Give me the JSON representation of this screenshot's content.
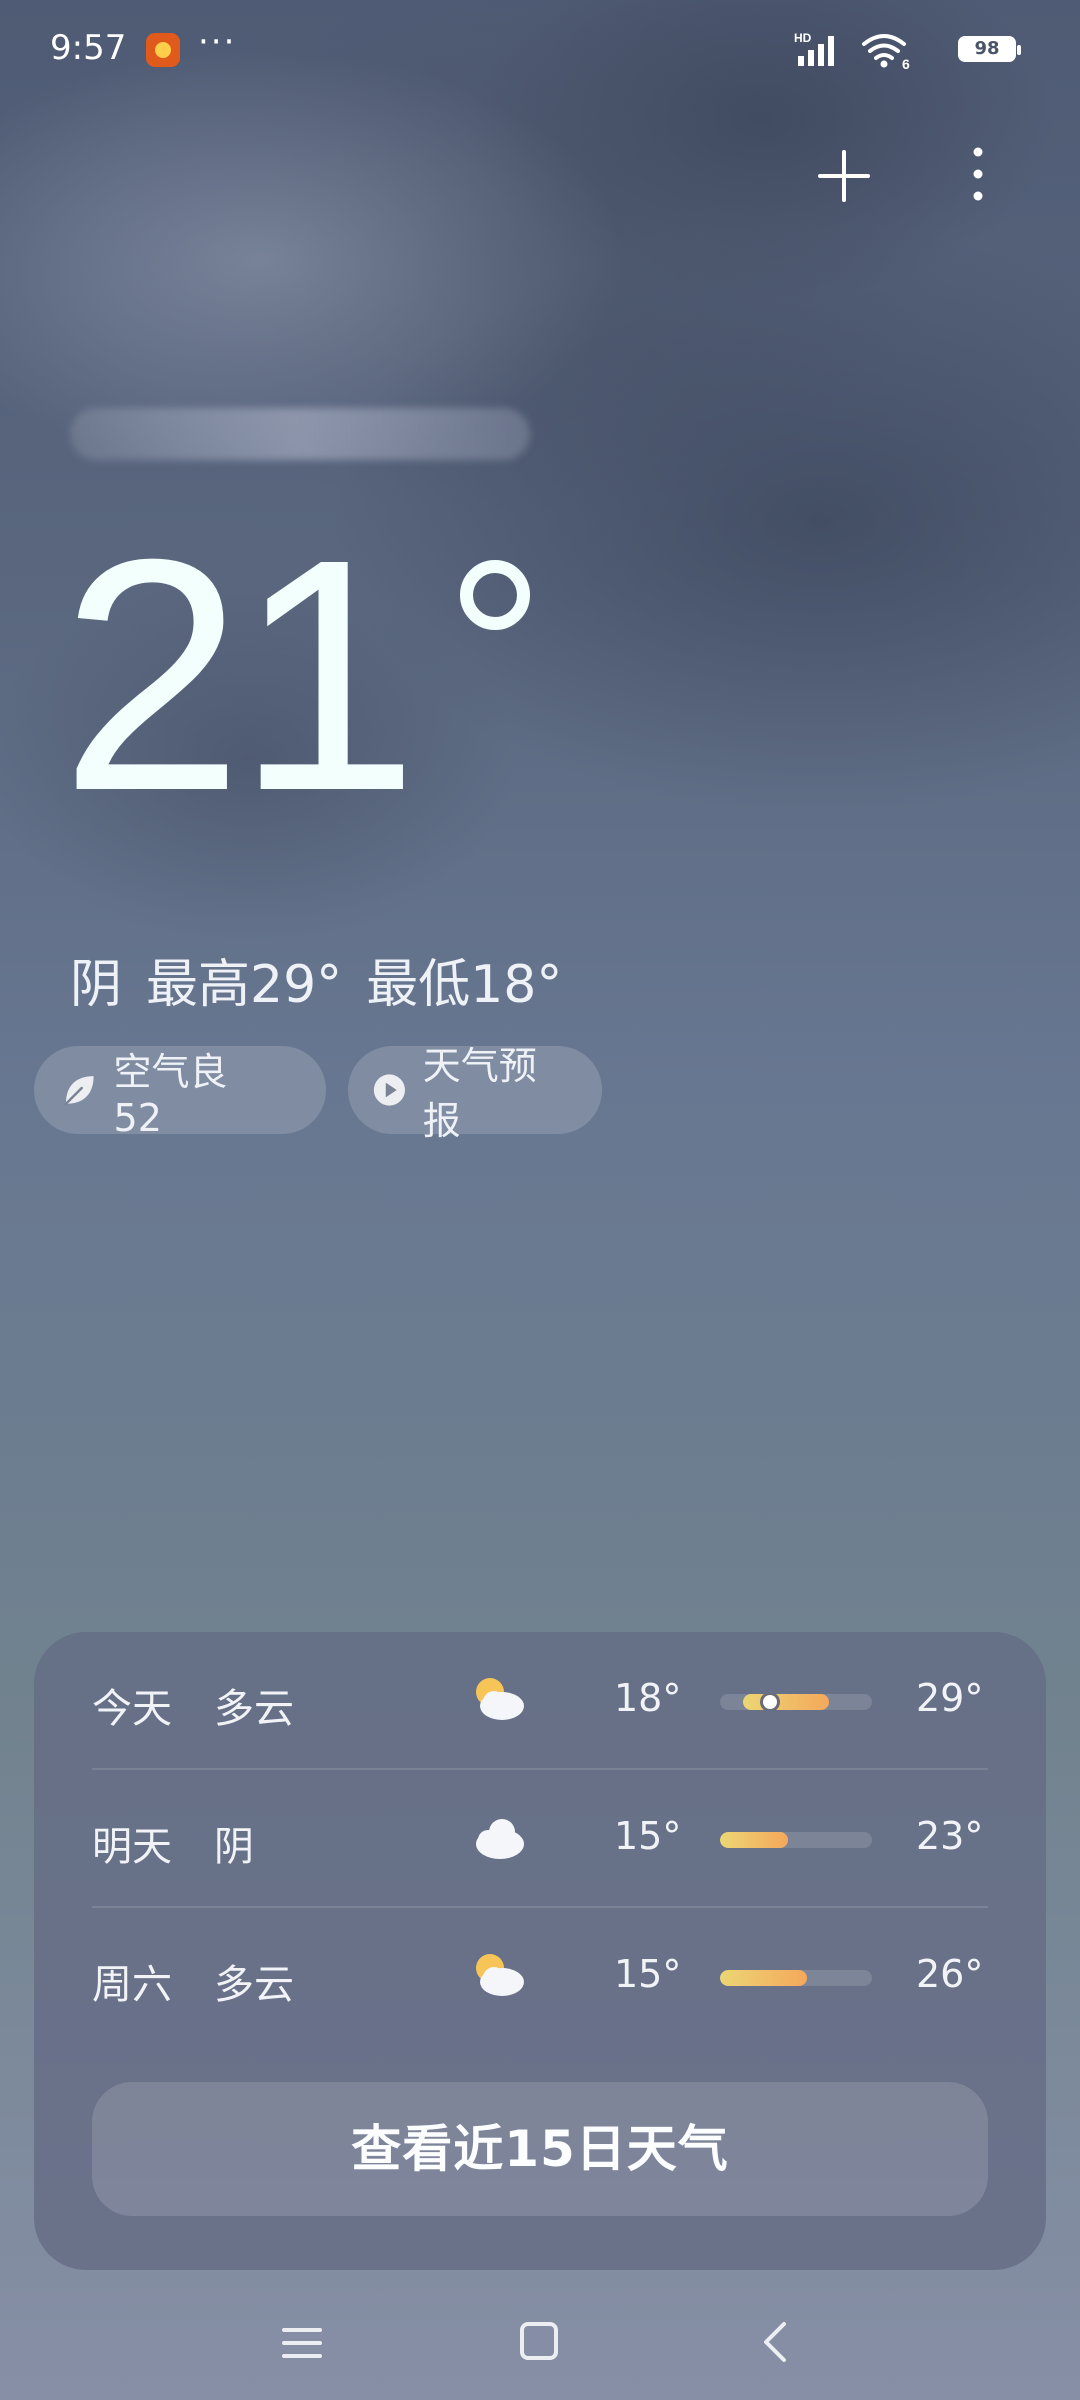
{
  "status_bar": {
    "time": "9:57",
    "overflow": "···",
    "network_tag": "HD",
    "wifi_tag": "6",
    "battery": "98"
  },
  "header": {
    "add_city_icon": "plus-icon",
    "more_icon": "kebab-icon"
  },
  "current": {
    "temperature": "21",
    "condition": "阴",
    "high": "最高29°",
    "low": "最低18°"
  },
  "chips": {
    "air_quality": "空气良 52",
    "forecast_video": "天气预报"
  },
  "forecast": [
    {
      "day": "今天",
      "condition": "多云",
      "icon": "partly-cloudy-icon",
      "low": "18°",
      "high": "29°",
      "bar_start": 0.15,
      "bar_end": 0.72,
      "current_marker": 0.33
    },
    {
      "day": "明天",
      "condition": "阴",
      "icon": "cloudy-icon",
      "low": "15°",
      "high": "23°",
      "bar_start": 0.0,
      "bar_end": 0.45
    },
    {
      "day": "周六",
      "condition": "多云",
      "icon": "partly-cloudy-icon",
      "low": "15°",
      "high": "26°",
      "bar_start": 0.0,
      "bar_end": 0.57
    }
  ],
  "cta": {
    "label": "查看近15日天气"
  },
  "colors": {
    "bar_start": "#ecd674",
    "bar_end": "#f4a85b",
    "battery_text": "#4a5468"
  }
}
